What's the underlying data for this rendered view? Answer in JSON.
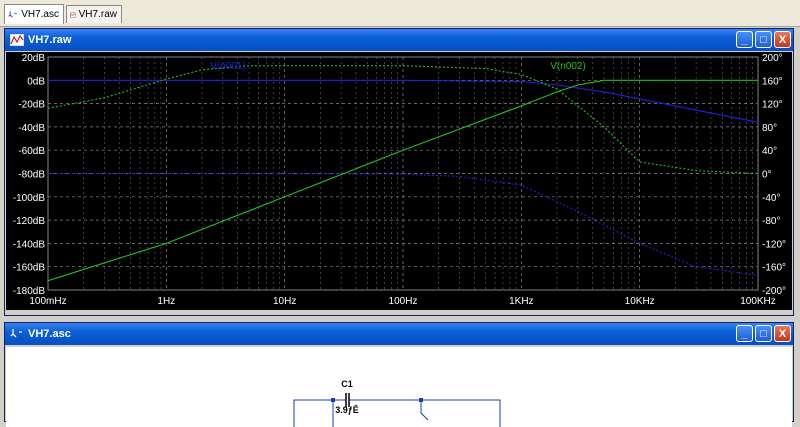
{
  "tabs": [
    {
      "label": "VH7.asc",
      "icon": "schematic-icon"
    },
    {
      "label": "VH7.raw",
      "icon": "waveform-icon"
    }
  ],
  "plot_window": {
    "title": "VH7.raw",
    "icon": "waveform-icon"
  },
  "schematic_window": {
    "title": "VH7.asc",
    "icon": "schematic-icon"
  },
  "window_buttons": {
    "minimize": "_",
    "maximize": "□",
    "close": "X"
  },
  "chart_data": {
    "type": "line",
    "x_scale": "log",
    "x_ticks": [
      "100mHz",
      "1Hz",
      "10Hz",
      "100Hz",
      "1KHz",
      "10KHz",
      "100KHz"
    ],
    "x_tick_values": [
      0.1,
      1,
      10,
      100,
      1000,
      10000,
      100000
    ],
    "xlim": [
      0.1,
      100000
    ],
    "y_left_ticks": [
      "20dB",
      "0dB",
      "-20dB",
      "-40dB",
      "-60dB",
      "-80dB",
      "-100dB",
      "-120dB",
      "-140dB",
      "-160dB",
      "-180dB"
    ],
    "y_left_range": [
      -180,
      20
    ],
    "y_right_ticks": [
      "200°",
      "160°",
      "120°",
      "80°",
      "40°",
      "0°",
      "-40°",
      "-80°",
      "-120°",
      "-160°",
      "-200°"
    ],
    "y_right_range": [
      -200,
      200
    ],
    "grid": true,
    "legend": [
      {
        "name": "V(n001)",
        "color": "#2020e0"
      },
      {
        "name": "V(n002)",
        "color": "#20c020"
      }
    ],
    "series": [
      {
        "name": "V(n001)",
        "color": "#2020e0",
        "kind": "magnitude",
        "x": [
          0.1,
          1,
          10,
          100,
          1000,
          2000,
          5000,
          10000,
          20000,
          50000,
          100000
        ],
        "y": [
          0,
          0,
          0,
          0,
          -1,
          -4,
          -10,
          -16,
          -22,
          -30,
          -36
        ]
      },
      {
        "name": "V(n001)",
        "color": "#2020e0",
        "kind": "phase",
        "x": [
          0.1,
          1,
          10,
          100,
          300,
          1000,
          3000,
          10000,
          30000,
          100000
        ],
        "y": [
          0,
          0,
          0,
          -1,
          -5,
          -20,
          -65,
          -120,
          -160,
          -175
        ]
      },
      {
        "name": "V(n002)",
        "color": "#20c020",
        "kind": "magnitude",
        "x": [
          0.1,
          1,
          10,
          100,
          1000,
          2000,
          3000,
          5000,
          10000,
          100000
        ],
        "y": [
          -172,
          -140,
          -100,
          -60,
          -22,
          -10,
          -4,
          0,
          0,
          0
        ]
      },
      {
        "name": "V(n002)",
        "color": "#20c020",
        "kind": "phase",
        "x": [
          0.1,
          0.3,
          1,
          2,
          5,
          10,
          100,
          500,
          1000,
          2000,
          5000,
          10000,
          30000,
          100000
        ],
        "y": [
          112,
          130,
          162,
          178,
          185,
          185,
          185,
          180,
          170,
          145,
          80,
          20,
          5,
          0
        ]
      }
    ]
  },
  "schematic": {
    "component": {
      "ref": "C1",
      "value": "3.9ƒÊ"
    }
  }
}
